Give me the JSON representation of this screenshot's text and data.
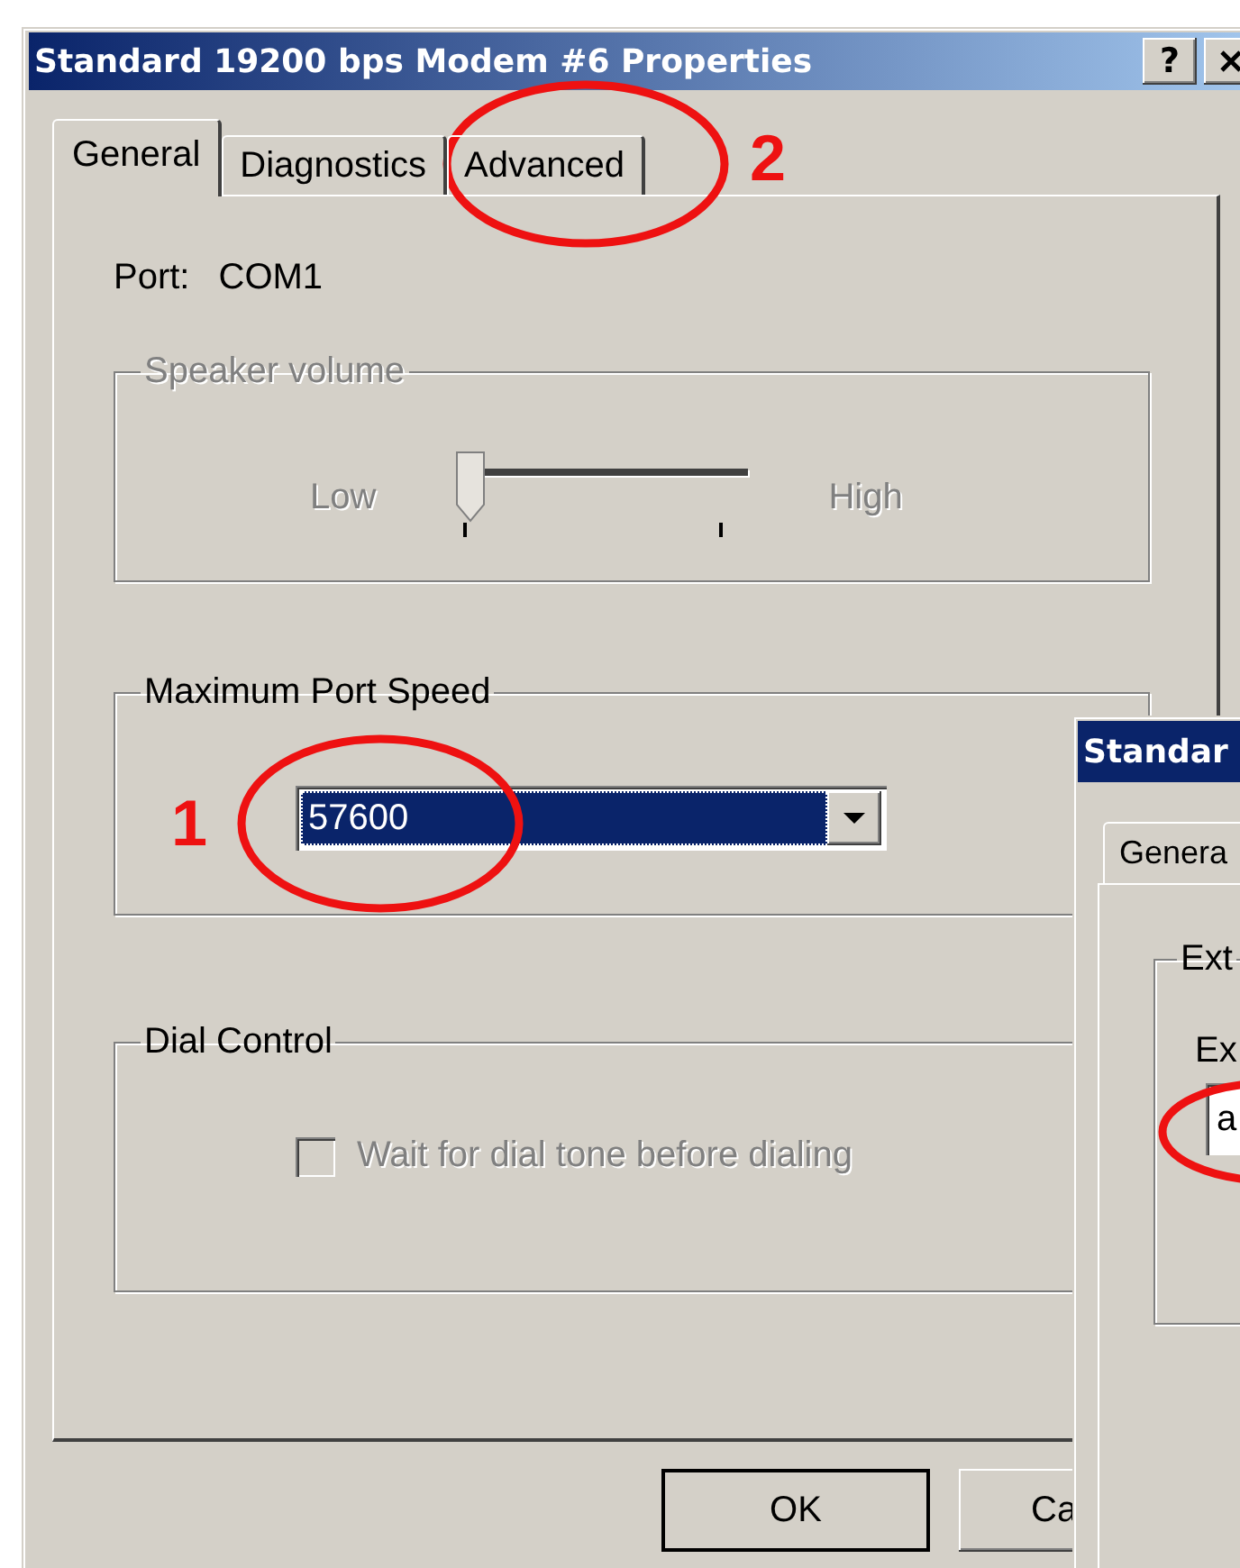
{
  "window": {
    "title": "Standard 19200 bps Modem #6 Properties",
    "help_button": "?"
  },
  "tabs": [
    {
      "label": "General",
      "selected": true
    },
    {
      "label": "Diagnostics",
      "selected": false
    },
    {
      "label": "Advanced",
      "selected": false
    }
  ],
  "port": {
    "label": "Port:",
    "value": "COM1"
  },
  "speaker_volume": {
    "title": "Speaker volume",
    "disabled": true,
    "low_label": "Low",
    "high_label": "High",
    "level": 0
  },
  "max_port_speed": {
    "title": "Maximum Port Speed",
    "value": "57600"
  },
  "dial_control": {
    "title": "Dial Control",
    "checkbox": {
      "label": "Wait for dial tone before dialing",
      "checked": false,
      "disabled": true
    }
  },
  "buttons": [
    "OK",
    "Ca"
  ],
  "second_window": {
    "title": "Standar",
    "tab": "Genera",
    "group_title": "Ext",
    "field_label": "Ex",
    "field_value": "a"
  },
  "annotations": [
    {
      "label": "1"
    },
    {
      "label": "2"
    }
  ]
}
